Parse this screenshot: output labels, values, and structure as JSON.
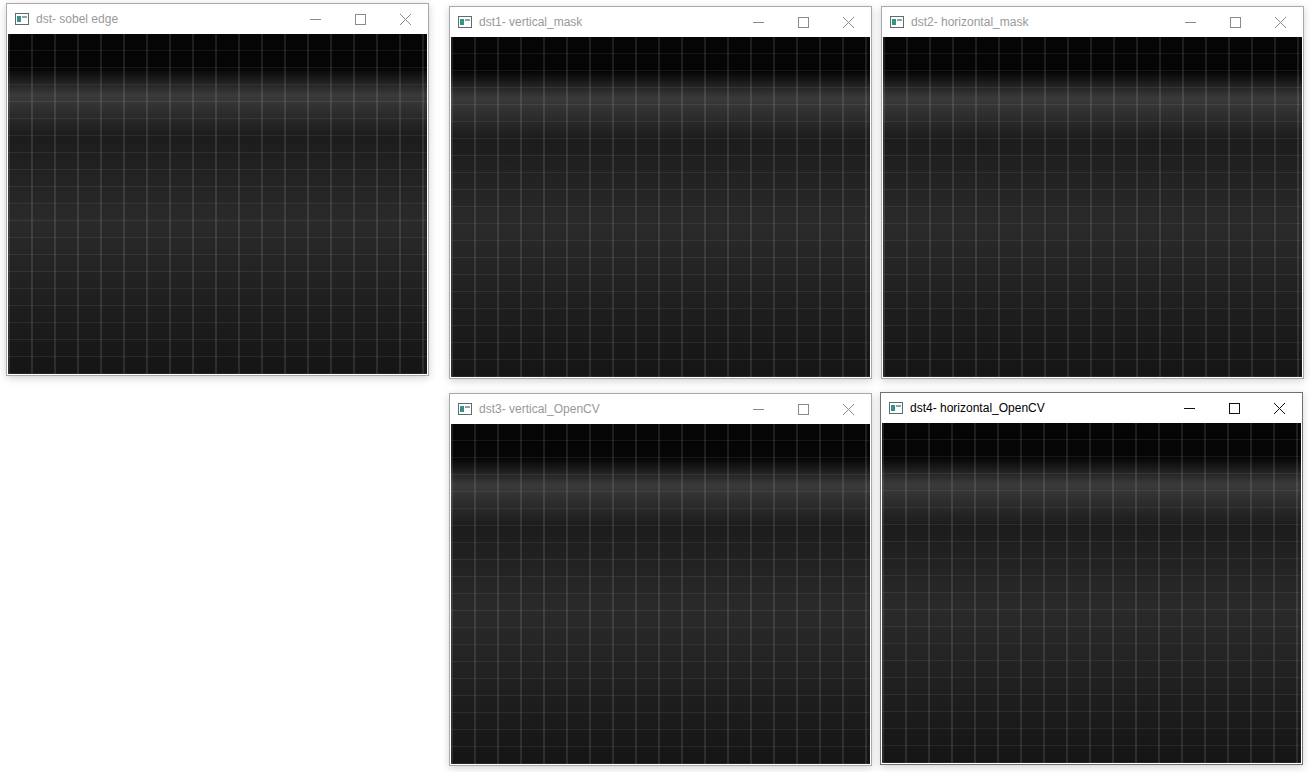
{
  "windows": [
    {
      "title": "dst- sobel edge",
      "active": false
    },
    {
      "title": "dst1- vertical_mask",
      "active": false
    },
    {
      "title": "dst2- horizontal_mask",
      "active": false
    },
    {
      "title": "dst3- vertical_OpenCV",
      "active": false
    },
    {
      "title": "dst4- horizontal_OpenCV",
      "active": true
    }
  ]
}
